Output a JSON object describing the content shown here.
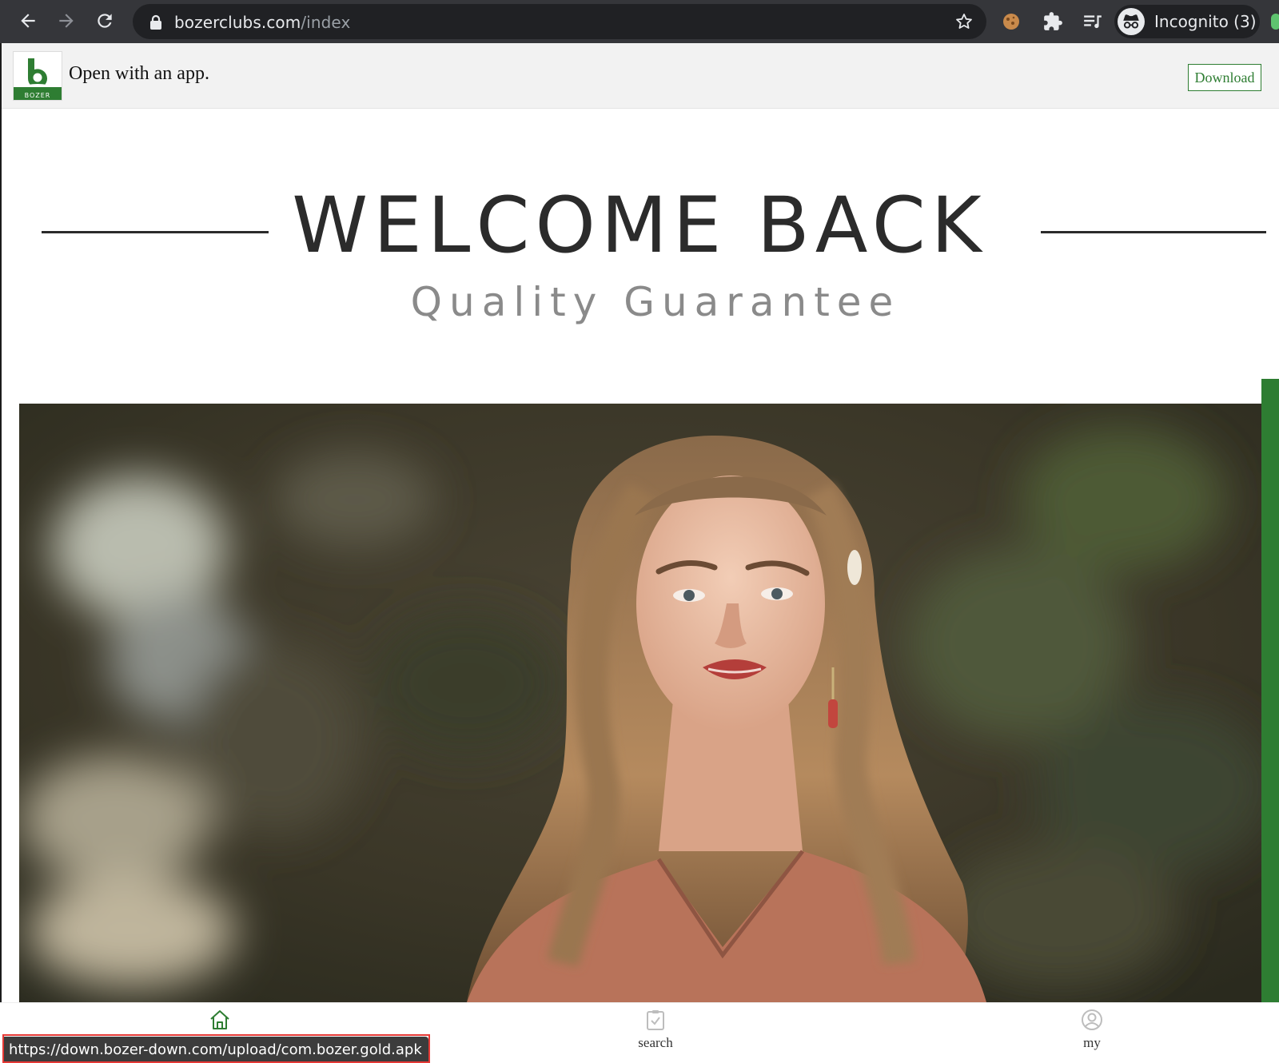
{
  "browser": {
    "url_host": "bozerclubs.com",
    "url_path": "/index",
    "incognito_label": "Incognito (3)",
    "icons": [
      "back-arrow-icon",
      "forward-arrow-icon",
      "reload-icon",
      "lock-icon",
      "star-icon",
      "cookie-icon",
      "puzzle-icon",
      "media-queue-icon",
      "incognito-icon"
    ]
  },
  "app_banner": {
    "text": "Open with an app.",
    "download_label": "Download",
    "logo_text": "BOZER",
    "accent": "#2e7d32"
  },
  "hero": {
    "title": "WELCOME BACK",
    "subtitle": "Quality Guarantee"
  },
  "bottom_nav": {
    "tabs": [
      {
        "icon": "home-icon",
        "label": ""
      },
      {
        "icon": "clipboard-check-icon",
        "label": "search"
      },
      {
        "icon": "user-circle-icon",
        "label": "my"
      }
    ]
  },
  "status_bar": {
    "link_url": "https://down.bozer-down.com/upload/com.bozer.gold.apk"
  }
}
